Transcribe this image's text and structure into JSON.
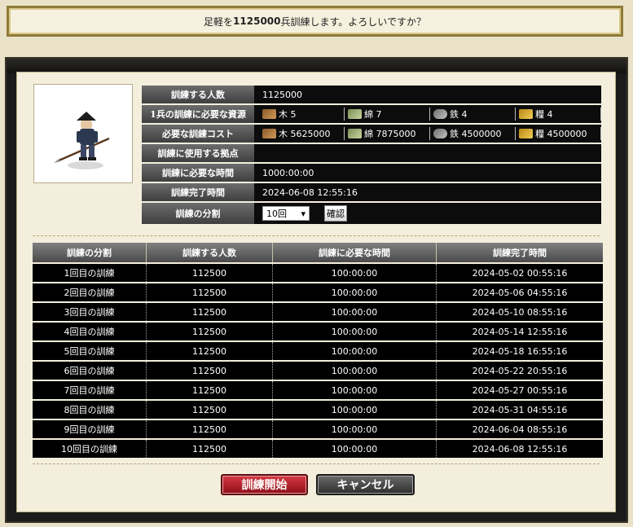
{
  "confirm": {
    "prefix": "足軽を",
    "count": "1125000",
    "suffix": "兵訓練します。よろしいですか？"
  },
  "info": {
    "rows": [
      {
        "label": "訓練する人数",
        "value": "1125000"
      },
      {
        "label": "1兵の訓練に必要な資源"
      },
      {
        "label": "必要な訓練コスト"
      },
      {
        "label": "訓練に使用する拠点",
        "value": ""
      },
      {
        "label": "訓練に必要な時間",
        "value": "1000:00:00"
      },
      {
        "label": "訓練完了時間",
        "value": "2024-06-08 12:55:16"
      },
      {
        "label": "訓練の分割"
      }
    ],
    "per_unit": [
      {
        "name": "木",
        "amount": "5",
        "icon": "wood-icon"
      },
      {
        "name": "綿",
        "amount": "7",
        "icon": "cotton-icon"
      },
      {
        "name": "鉄",
        "amount": "4",
        "icon": "iron-icon"
      },
      {
        "name": "糧",
        "amount": "4",
        "icon": "food-icon"
      }
    ],
    "total_cost": [
      {
        "name": "木",
        "amount": "5625000",
        "icon": "wood-icon"
      },
      {
        "name": "綿",
        "amount": "7875000",
        "icon": "cotton-icon"
      },
      {
        "name": "鉄",
        "amount": "4500000",
        "icon": "iron-icon"
      },
      {
        "name": "糧",
        "amount": "4500000",
        "icon": "food-icon"
      }
    ],
    "split_value": "10回",
    "confirm_button": "確認"
  },
  "schedule": {
    "headers": [
      "訓練の分割",
      "訓練する人数",
      "訓練に必要な時間",
      "訓練完了時間"
    ],
    "rows": [
      [
        "1回目の訓練",
        "112500",
        "100:00:00",
        "2024-05-02 00:55:16"
      ],
      [
        "2回目の訓練",
        "112500",
        "100:00:00",
        "2024-05-06 04:55:16"
      ],
      [
        "3回目の訓練",
        "112500",
        "100:00:00",
        "2024-05-10 08:55:16"
      ],
      [
        "4回目の訓練",
        "112500",
        "100:00:00",
        "2024-05-14 12:55:16"
      ],
      [
        "5回目の訓練",
        "112500",
        "100:00:00",
        "2024-05-18 16:55:16"
      ],
      [
        "6回目の訓練",
        "112500",
        "100:00:00",
        "2024-05-22 20:55:16"
      ],
      [
        "7回目の訓練",
        "112500",
        "100:00:00",
        "2024-05-27 00:55:16"
      ],
      [
        "8回目の訓練",
        "112500",
        "100:00:00",
        "2024-05-31 04:55:16"
      ],
      [
        "9回目の訓練",
        "112500",
        "100:00:00",
        "2024-06-04 08:55:16"
      ],
      [
        "10回目の訓練",
        "112500",
        "100:00:00",
        "2024-06-08 12:55:16"
      ]
    ]
  },
  "buttons": {
    "start": "訓練開始",
    "cancel": "キャンセル"
  }
}
